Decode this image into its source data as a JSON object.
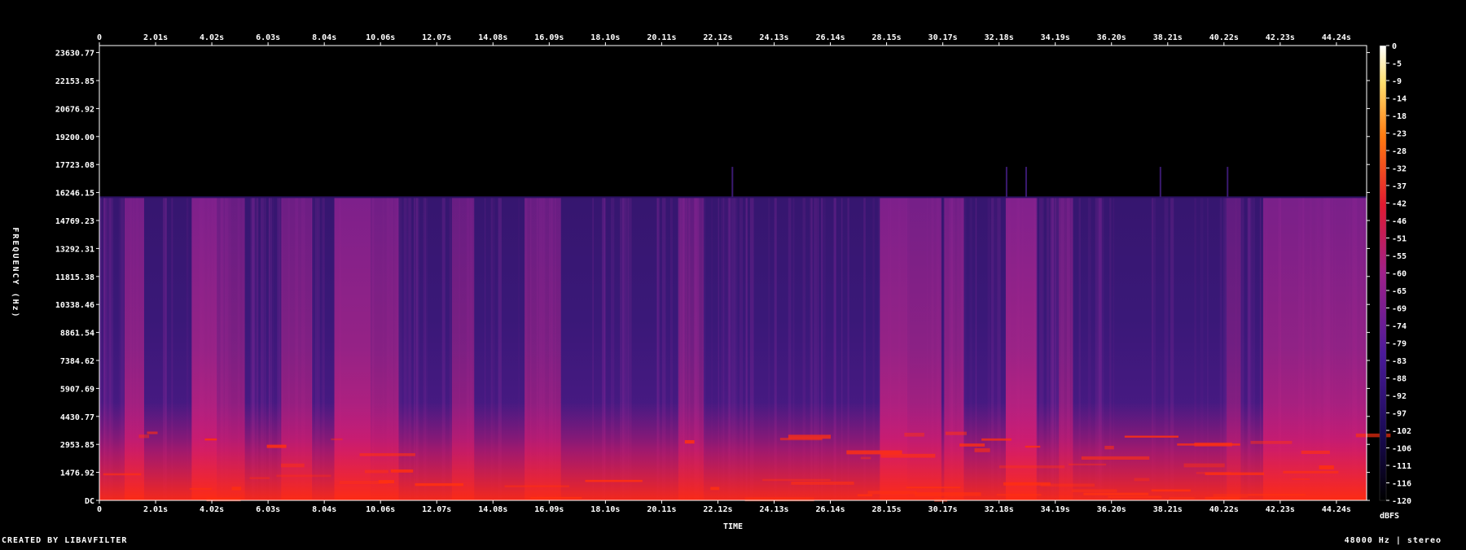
{
  "chart_data": {
    "type": "heatmap",
    "xlabel": "TIME",
    "ylabel": "FREQUENCY (Hz)",
    "x_ticks": [
      "0",
      "2.01s",
      "4.02s",
      "6.03s",
      "8.04s",
      "10.06s",
      "12.07s",
      "14.08s",
      "16.09s",
      "18.10s",
      "20.11s",
      "22.12s",
      "24.13s",
      "26.14s",
      "28.15s",
      "30.17s",
      "32.18s",
      "34.19s",
      "36.20s",
      "38.21s",
      "40.22s",
      "42.23s",
      "44.24s"
    ],
    "y_ticks": [
      "23630.77",
      "22153.85",
      "20676.92",
      "19200.00",
      "17723.08",
      "16246.15",
      "14769.23",
      "13292.31",
      "11815.38",
      "10338.46",
      "8861.54",
      "7384.62",
      "5907.69",
      "4430.77",
      "2953.85",
      "1476.92",
      "DC"
    ],
    "xlim": [
      0,
      45.3
    ],
    "ylim": [
      0,
      24000
    ],
    "colorbar_label": "dBFS",
    "colorbar_ticks": [
      "0",
      "-5",
      "-9",
      "-14",
      "-18",
      "-23",
      "-28",
      "-32",
      "-37",
      "-42",
      "-46",
      "-51",
      "-55",
      "-60",
      "-65",
      "-69",
      "-74",
      "-79",
      "-83",
      "-88",
      "-92",
      "-97",
      "-102",
      "-106",
      "-111",
      "-116",
      "-120"
    ],
    "cutoff_hz": 16000,
    "loud_segments": [
      {
        "t0": 0.9,
        "t1": 1.6,
        "level": 0.75
      },
      {
        "t0": 3.3,
        "t1": 4.2,
        "level": 0.85
      },
      {
        "t0": 4.2,
        "t1": 5.2,
        "level": 0.6
      },
      {
        "t0": 6.5,
        "t1": 7.6,
        "level": 0.65
      },
      {
        "t0": 8.4,
        "t1": 9.7,
        "level": 0.85
      },
      {
        "t0": 9.7,
        "t1": 10.7,
        "level": 0.7
      },
      {
        "t0": 12.6,
        "t1": 13.4,
        "level": 0.6
      },
      {
        "t0": 15.2,
        "t1": 16.5,
        "level": 0.6
      },
      {
        "t0": 20.7,
        "t1": 21.6,
        "level": 0.5
      },
      {
        "t0": 27.9,
        "t1": 28.9,
        "level": 0.85
      },
      {
        "t0": 28.9,
        "t1": 30.1,
        "level": 0.75
      },
      {
        "t0": 30.2,
        "t1": 30.9,
        "level": 0.7
      },
      {
        "t0": 32.4,
        "t1": 33.5,
        "level": 0.9
      },
      {
        "t0": 34.3,
        "t1": 34.8,
        "level": 0.55
      },
      {
        "t0": 40.3,
        "t1": 40.8,
        "level": 0.5
      },
      {
        "t0": 41.6,
        "t1": 45.3,
        "level": 0.8
      }
    ]
  },
  "footer": {
    "created_by": "CREATED BY LIBAVFILTER",
    "sample_info": "48000 Hz | stereo"
  }
}
